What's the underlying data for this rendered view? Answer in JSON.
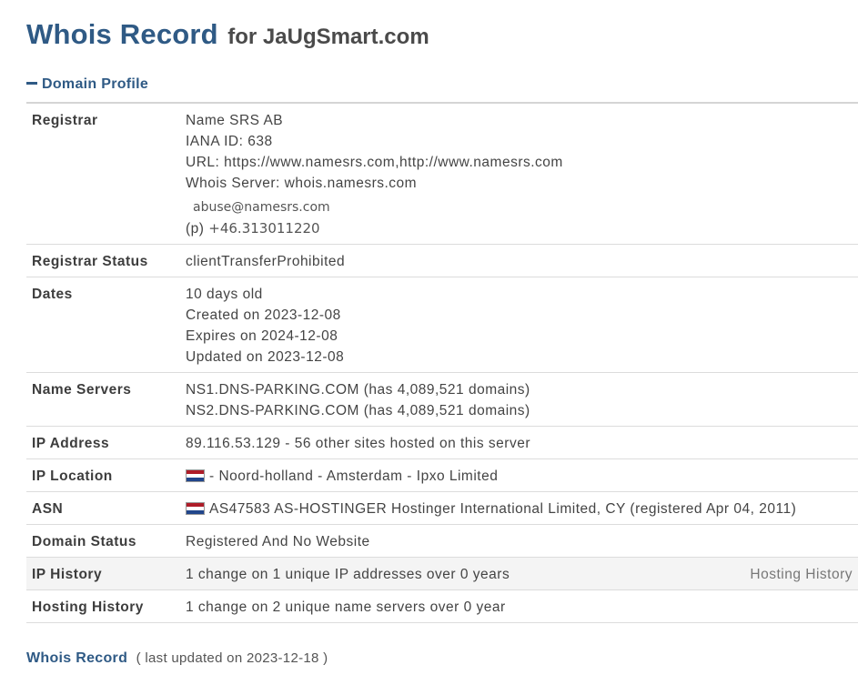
{
  "header": {
    "title": "Whois Record",
    "subtitle": "for JaUgSmart.com"
  },
  "section": {
    "label": "Domain Profile"
  },
  "registrar": {
    "label": "Registrar",
    "name": "Name SRS AB",
    "iana": "IANA ID: 638",
    "url": "URL: https://www.namesrs.com,http://www.namesrs.com",
    "whois_server": "Whois Server: whois.namesrs.com",
    "email": "abuse@namesrs.com",
    "phone_prefix": "(p)",
    "phone": "+46.313011220"
  },
  "registrar_status": {
    "label": "Registrar Status",
    "value": "clientTransferProhibited"
  },
  "dates": {
    "label": "Dates",
    "age": "10 days old",
    "created": "Created on 2023-12-08",
    "expires": "Expires on 2024-12-08",
    "updated": "Updated on 2023-12-08"
  },
  "name_servers": {
    "label": "Name Servers",
    "ns1": "NS1.DNS-PARKING.COM (has 4,089,521 domains)",
    "ns2": "NS2.DNS-PARKING.COM (has 4,089,521 domains)"
  },
  "ip_address": {
    "label": "IP Address",
    "value": "89.116.53.129 - 56 other sites hosted on this server"
  },
  "ip_location": {
    "label": "IP Location",
    "value": "- Noord-holland - Amsterdam - Ipxo Limited",
    "flag_icon": "netherlands-flag-icon"
  },
  "asn": {
    "label": "ASN",
    "value": "AS47583 AS-HOSTINGER Hostinger International Limited, CY (registered Apr 04, 2011)",
    "flag_icon": "netherlands-flag-icon"
  },
  "domain_status": {
    "label": "Domain Status",
    "value": "Registered And No Website"
  },
  "ip_history": {
    "label": "IP History",
    "value": "1 change on 1 unique IP addresses over 0 years",
    "link": "Hosting History"
  },
  "hosting_history": {
    "label": "Hosting History",
    "value": "1 change on 2 unique name servers over 0 year"
  },
  "footer": {
    "link": "Whois Record",
    "note": "( last updated on 2023-12-18 )"
  },
  "colors": {
    "heading": "#2f5a85",
    "shaded_row": "#f4f4f4",
    "border": "#dcdcdc"
  }
}
